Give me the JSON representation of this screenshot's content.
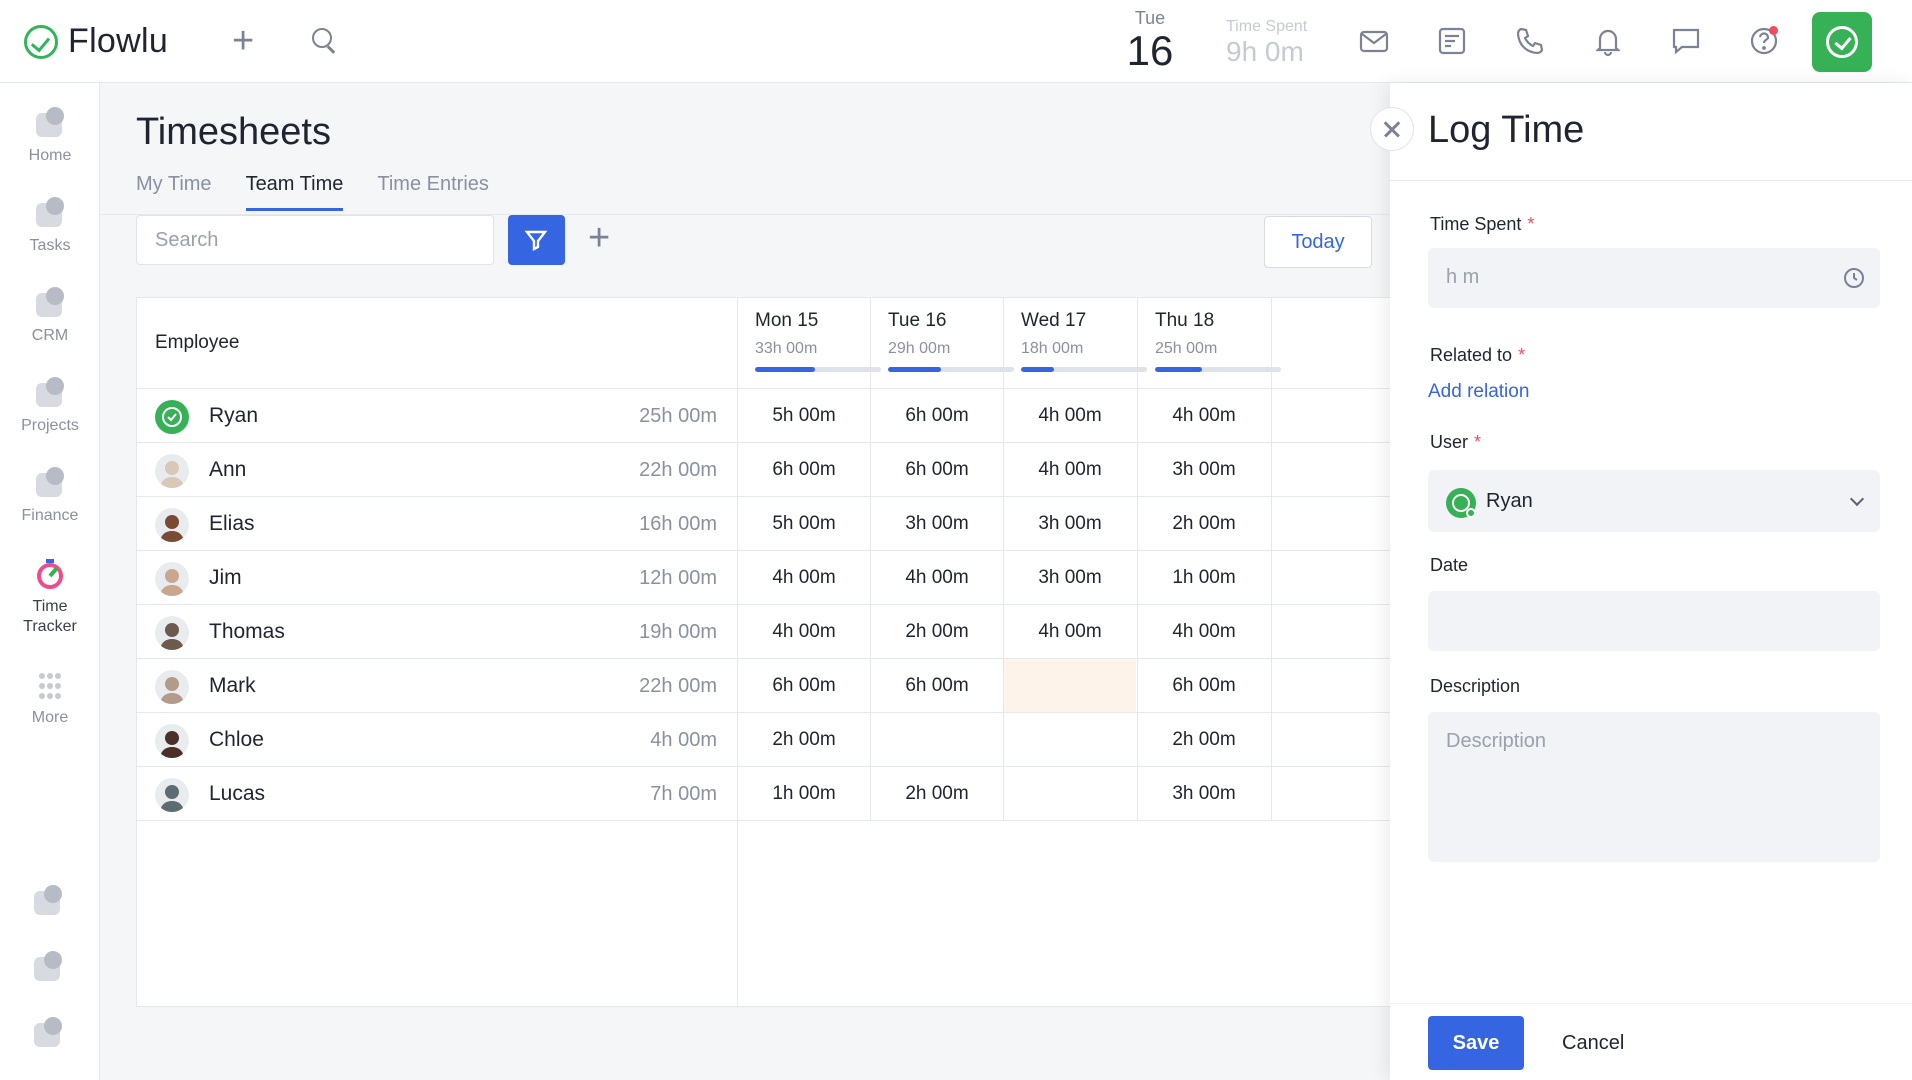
{
  "app": {
    "name": "Flowlu"
  },
  "header": {
    "date_day": "Tue",
    "date_num": "16",
    "time_spent_label": "Time Spent",
    "time_spent_value": "9h 0m",
    "icons": [
      "mail-icon",
      "notes-icon",
      "phone-icon",
      "bell-icon",
      "chat-icon",
      "help-icon"
    ]
  },
  "sidebar": {
    "items": [
      {
        "label": "Home"
      },
      {
        "label": "Tasks"
      },
      {
        "label": "CRM"
      },
      {
        "label": "Projects"
      },
      {
        "label": "Finance"
      },
      {
        "label": "Time\nTracker"
      },
      {
        "label": "More"
      }
    ]
  },
  "main": {
    "title": "Timesheets",
    "tabs": [
      {
        "label": "My Time"
      },
      {
        "label": "Team Time"
      },
      {
        "label": "Time Entries"
      }
    ],
    "search_placeholder": "Search",
    "today_label": "Today",
    "table": {
      "employee_header": "Employee",
      "days": [
        {
          "name": "Mon 15",
          "total": "33h 00m",
          "progress": 0.48
        },
        {
          "name": "Tue 16",
          "total": "29h 00m",
          "progress": 0.42
        },
        {
          "name": "Wed 17",
          "total": "18h 00m",
          "progress": 0.26
        },
        {
          "name": "Thu 18",
          "total": "25h 00m",
          "progress": 0.37
        }
      ],
      "rows": [
        {
          "name": "Ryan",
          "total": "25h 00m",
          "cells": [
            "5h 00m",
            "6h 00m",
            "4h 00m",
            "4h 00m"
          ],
          "color": "#36b156"
        },
        {
          "name": "Ann",
          "total": "22h 00m",
          "cells": [
            "6h 00m",
            "6h 00m",
            "4h 00m",
            "3h 00m"
          ],
          "color": "#d9c7b8"
        },
        {
          "name": "Elias",
          "total": "16h 00m",
          "cells": [
            "5h 00m",
            "3h 00m",
            "3h 00m",
            "2h 00m"
          ],
          "color": "#7a4a35"
        },
        {
          "name": "Jim",
          "total": "12h 00m",
          "cells": [
            "4h 00m",
            "4h 00m",
            "3h 00m",
            "1h 00m"
          ],
          "color": "#c9a68e"
        },
        {
          "name": "Thomas",
          "total": "19h 00m",
          "cells": [
            "4h 00m",
            "2h 00m",
            "4h 00m",
            "4h 00m"
          ],
          "color": "#6e5a4d"
        },
        {
          "name": "Mark",
          "total": "22h 00m",
          "cells": [
            "6h 00m",
            "6h 00m",
            "",
            "6h 00m"
          ],
          "color": "#b39a8a"
        },
        {
          "name": "Chloe",
          "total": "4h 00m",
          "cells": [
            "2h 00m",
            "",
            "",
            "2h 00m"
          ],
          "color": "#4a3028"
        },
        {
          "name": "Lucas",
          "total": "7h 00m",
          "cells": [
            "1h 00m",
            "2h 00m",
            "",
            "3h 00m"
          ],
          "color": "#5d6b73"
        }
      ]
    }
  },
  "panel": {
    "title": "Log Time",
    "time_spent_label": "Time Spent",
    "time_spent_placeholder": "h m",
    "related_label": "Related to",
    "add_relation": "Add relation",
    "user_label": "User",
    "user_value": "Ryan",
    "date_label": "Date",
    "description_label": "Description",
    "description_placeholder": "Description",
    "save_label": "Save",
    "cancel_label": "Cancel"
  }
}
